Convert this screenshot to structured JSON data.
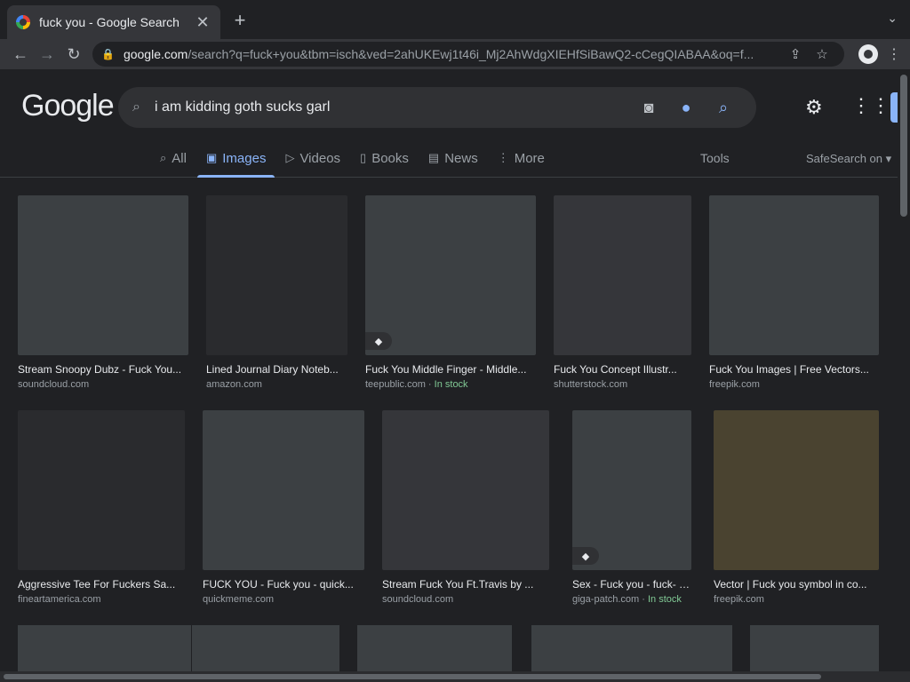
{
  "browser": {
    "tab_title": "fuck you - Google Search",
    "tab_close": "✕",
    "new_tab": "+",
    "tab_menu": "⌄",
    "url_host": "google.com",
    "url_path": "/search?q=fuck+you&tbm=isch&ved=2ahUKEwj1t46i_Mj2AhWdgXIEHfSiBawQ2-cCegQIABAA&oq=f...",
    "back": "←",
    "forward": "→",
    "reload": "↻",
    "lock": "🔒",
    "share": "⇪",
    "bookmark": "☆",
    "menu": "⋮"
  },
  "google": {
    "logo": "Google",
    "search_value": "i am kidding goth sucks garl",
    "settings": "⚙",
    "apps": "⋮⋮⋮",
    "tabs": [
      {
        "icon": "⌕",
        "label": "All"
      },
      {
        "icon": "▣",
        "label": "Images"
      },
      {
        "icon": "▷",
        "label": "Videos"
      },
      {
        "icon": "▯",
        "label": "Books"
      },
      {
        "icon": "▤",
        "label": "News"
      },
      {
        "icon": "⋮",
        "label": "More"
      }
    ],
    "tools": "Tools",
    "safesearch": "SafeSearch on ▾"
  },
  "results": [
    {
      "title": "Stream Snoopy Dubz - Fuck You...",
      "source": "soundcloud.com",
      "stock": ""
    },
    {
      "title": "Lined Journal Diary Noteb...",
      "source": "amazon.com",
      "stock": ""
    },
    {
      "title": "Fuck You Middle Finger - Middle...",
      "source": "teepublic.com",
      "stock": "In stock"
    },
    {
      "title": "Fuck You Concept Illustr...",
      "source": "shutterstock.com",
      "stock": ""
    },
    {
      "title": "Fuck You Images | Free Vectors...",
      "source": "freepik.com",
      "stock": ""
    },
    {
      "title": "Aggressive Tee For Fuckers Sa...",
      "source": "fineartamerica.com",
      "stock": ""
    },
    {
      "title": "FUCK YOU - Fuck you - quick...",
      "source": "quickmeme.com",
      "stock": ""
    },
    {
      "title": "Stream Fuck You Ft.Travis by ...",
      "source": "soundcloud.com",
      "stock": ""
    },
    {
      "title": "Sex - Fuck you - fuck- P...",
      "source": "giga-patch.com",
      "stock": "In stock"
    },
    {
      "title": "Vector | Fuck you symbol in co...",
      "source": "freepik.com",
      "stock": ""
    }
  ],
  "colors": {
    "background": "#202124",
    "accent": "#8ab4f8",
    "in_stock": "#81c995"
  }
}
